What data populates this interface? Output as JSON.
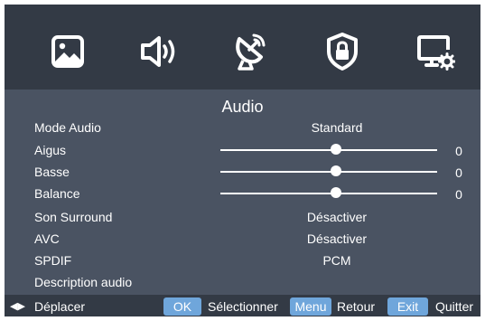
{
  "categories": [
    {
      "icon": "picture-icon"
    },
    {
      "icon": "sound-icon"
    },
    {
      "icon": "satellite-dish-icon"
    },
    {
      "icon": "lock-shield-icon"
    },
    {
      "icon": "monitor-settings-icon"
    }
  ],
  "menu": {
    "title": "Audio",
    "mode_audio": {
      "label": "Mode Audio",
      "value": "Standard"
    },
    "aigus": {
      "label": "Aigus",
      "value": "0"
    },
    "basse": {
      "label": "Basse",
      "value": "0"
    },
    "balance": {
      "label": "Balance",
      "value": "0"
    },
    "son_surround": {
      "label": "Son Surround",
      "value": "Désactiver"
    },
    "avc": {
      "label": "AVC",
      "value": "Désactiver"
    },
    "spdif": {
      "label": "SPDIF",
      "value": "PCM"
    },
    "description_audio": {
      "label": "Description audio"
    }
  },
  "footer": {
    "move_label": "Déplacer",
    "ok_key": "OK",
    "select_label": "Sélectionner",
    "menu_key": "Menu",
    "back_label": "Retour",
    "exit_key": "Exit",
    "quit_label": "Quitter"
  },
  "colors": {
    "background": "#333a45",
    "panel": "#4a5362",
    "key_badge": "#6fa6db",
    "text": "#ffffff"
  }
}
